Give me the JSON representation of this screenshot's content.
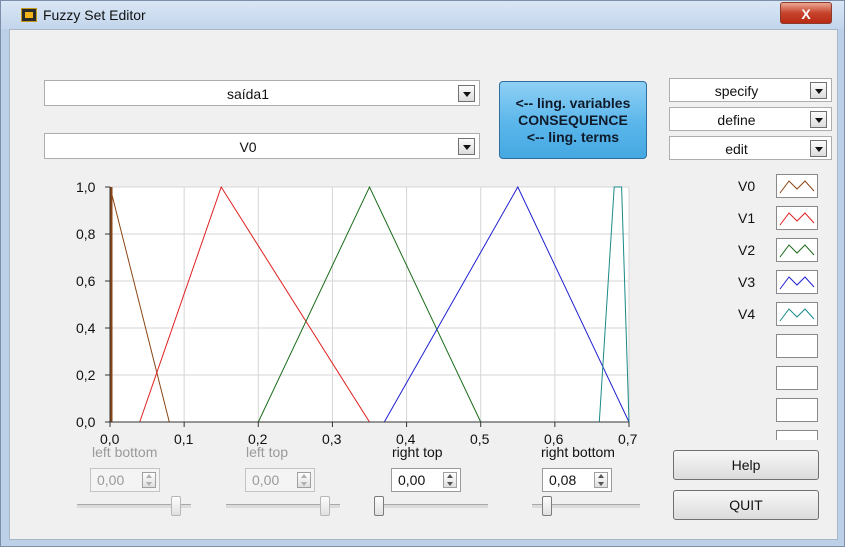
{
  "window": {
    "title": "Fuzzy Set Editor",
    "close_glyph": "X"
  },
  "selectors": {
    "variable": "saída1",
    "term": "V0"
  },
  "consequence_button": {
    "line1": "<-- ling. variables",
    "line2": "CONSEQUENCE",
    "line3": "<-- ling. terms"
  },
  "right_rings": {
    "specify": "specify",
    "define": "define",
    "edit": "edit"
  },
  "legend": {
    "items": [
      {
        "label": "V0",
        "color": "#8b4513"
      },
      {
        "label": "V1",
        "color": "#e02020"
      },
      {
        "label": "V2",
        "color": "#1a6b1a"
      },
      {
        "label": "V3",
        "color": "#2020d0"
      },
      {
        "label": "V4",
        "color": "#1a8a8a"
      }
    ]
  },
  "chart_data": {
    "type": "line",
    "x_range": [
      0,
      0.7
    ],
    "y_range": [
      0,
      1
    ],
    "x_ticks": [
      "0,0",
      "0,1",
      "0,2",
      "0,3",
      "0,4",
      "0,5",
      "0,6",
      "0,7"
    ],
    "y_ticks": [
      "0,0",
      "0,2",
      "0,4",
      "0,6",
      "0,8",
      "1,0"
    ],
    "grid": true,
    "series": [
      {
        "name": "V0",
        "color": "#8b4513",
        "points": [
          [
            0.0,
            1.0
          ],
          [
            0.08,
            0.0
          ]
        ]
      },
      {
        "name": "V1",
        "color": "#e02020",
        "points": [
          [
            0.04,
            0.0
          ],
          [
            0.15,
            1.0
          ],
          [
            0.35,
            0.0
          ]
        ]
      },
      {
        "name": "V2",
        "color": "#1a6b1a",
        "points": [
          [
            0.2,
            0.0
          ],
          [
            0.35,
            1.0
          ],
          [
            0.5,
            0.0
          ]
        ]
      },
      {
        "name": "V3",
        "color": "#2020d0",
        "points": [
          [
            0.37,
            0.0
          ],
          [
            0.55,
            1.0
          ],
          [
            0.7,
            0.0
          ]
        ]
      },
      {
        "name": "V4",
        "color": "#1a8a8a",
        "points": [
          [
            0.66,
            0.0
          ],
          [
            0.68,
            1.0
          ],
          [
            0.69,
            1.0
          ],
          [
            0.7,
            0.0
          ]
        ]
      }
    ]
  },
  "controls": {
    "left_bottom": {
      "label": "left bottom",
      "value": "0,00",
      "slider": 0.9
    },
    "left_top": {
      "label": "left top",
      "value": "0,00",
      "slider": 0.9
    },
    "right_top": {
      "label": "right top",
      "value": "0,00",
      "slider": 0.0
    },
    "right_bottom": {
      "label": "right bottom",
      "value": "0,08",
      "slider": 0.1
    }
  },
  "buttons": {
    "help": "Help",
    "quit": "QUIT"
  }
}
